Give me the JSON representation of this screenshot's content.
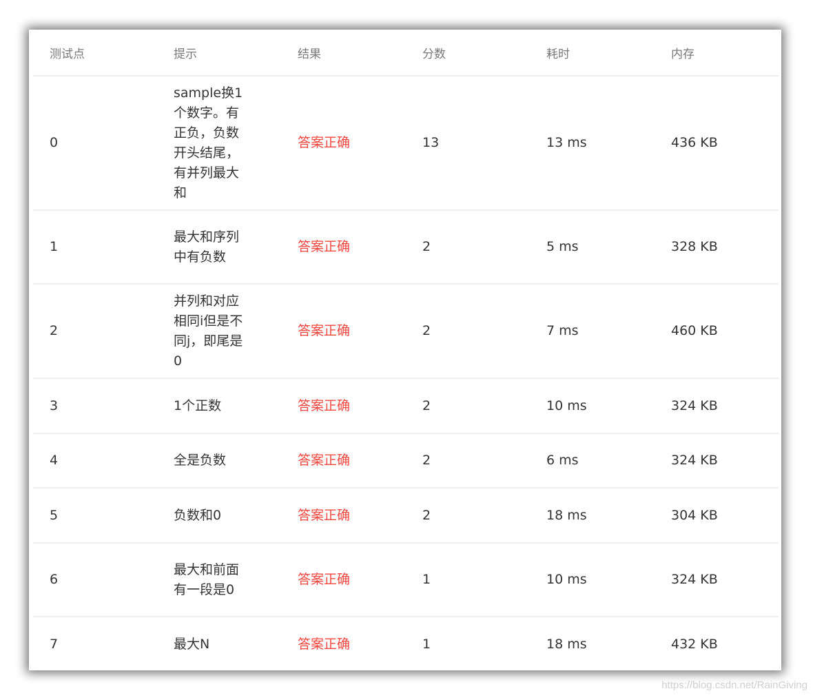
{
  "table": {
    "headers": [
      "测试点",
      "提示",
      "结果",
      "分数",
      "耗时",
      "内存"
    ],
    "rows": [
      {
        "id": "0",
        "hint": "sample换1个数字。有正负，负数开头结尾，有并列最大和",
        "result": "答案正确",
        "score": "13",
        "time": "13 ms",
        "memory": "436 KB"
      },
      {
        "id": "1",
        "hint": "最大和序列中有负数",
        "result": "答案正确",
        "score": "2",
        "time": "5 ms",
        "memory": "328 KB"
      },
      {
        "id": "2",
        "hint": "并列和对应相同i但是不同j，即尾是0",
        "result": "答案正确",
        "score": "2",
        "time": "7 ms",
        "memory": "460 KB"
      },
      {
        "id": "3",
        "hint": "1个正数",
        "result": "答案正确",
        "score": "2",
        "time": "10 ms",
        "memory": "324 KB"
      },
      {
        "id": "4",
        "hint": "全是负数",
        "result": "答案正确",
        "score": "2",
        "time": "6 ms",
        "memory": "324 KB"
      },
      {
        "id": "5",
        "hint": "负数和0",
        "result": "答案正确",
        "score": "2",
        "time": "18 ms",
        "memory": "304 KB"
      },
      {
        "id": "6",
        "hint": "最大和前面有一段是0",
        "result": "答案正确",
        "score": "1",
        "time": "10 ms",
        "memory": "324 KB"
      },
      {
        "id": "7",
        "hint": "最大N",
        "result": "答案正确",
        "score": "1",
        "time": "18 ms",
        "memory": "432 KB"
      }
    ]
  },
  "colors": {
    "result_correct": "#f2453d",
    "header_text": "#787878",
    "body_text": "#333333",
    "divider": "#eeeeee"
  },
  "watermark": "https://blog.csdn.net/RainGiving"
}
